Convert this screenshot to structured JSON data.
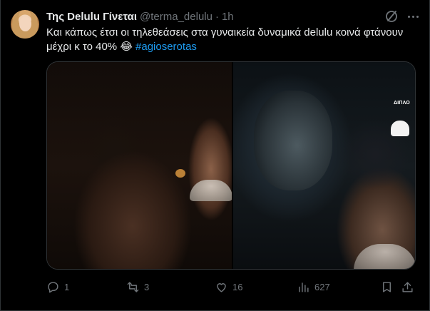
{
  "tweet": {
    "author_name": "Της Delulu Γίνεται",
    "handle": "@terma_delulu",
    "separator": "·",
    "time": "1h",
    "text_before": "Και κάπως έτσι οι τηλεθεάσεις στα γυναικεία δυναμικά delulu κοινά φτάνουν μέχρι κ το 40% 😂 ",
    "hashtag": "#agioserotas",
    "watermark": "ΔΙΠΛΟ"
  },
  "actions": {
    "replies": "1",
    "reposts": "3",
    "likes": "16",
    "views": "627"
  },
  "icons": {
    "grok": "grok-icon",
    "more": "more-icon",
    "reply": "reply-icon",
    "repost": "repost-icon",
    "like": "like-icon",
    "views": "views-icon",
    "bookmark": "bookmark-icon",
    "share": "share-icon"
  },
  "colors": {
    "background": "#000000",
    "text": "#e7e9ea",
    "muted": "#71767b",
    "accent": "#1d9bf0",
    "border": "#2f3336"
  }
}
